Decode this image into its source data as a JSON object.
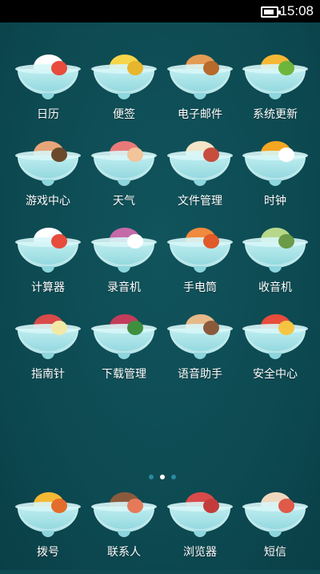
{
  "status_bar": {
    "time": "15:08",
    "battery_icon": "battery-icon"
  },
  "apps": [
    {
      "label": "日历",
      "icon": "calendar-icon",
      "colors": [
        "#ffffff",
        "#e74c3c"
      ]
    },
    {
      "label": "便签",
      "icon": "notes-icon",
      "colors": [
        "#f7d54a",
        "#e7b62d"
      ]
    },
    {
      "label": "电子邮件",
      "icon": "email-icon",
      "colors": [
        "#e39b55",
        "#b76a2c"
      ]
    },
    {
      "label": "系统更新",
      "icon": "system-update-icon",
      "colors": [
        "#f5b835",
        "#6db53c"
      ]
    },
    {
      "label": "游戏中心",
      "icon": "game-center-icon",
      "colors": [
        "#e7a57a",
        "#6a4a2a"
      ]
    },
    {
      "label": "天气",
      "icon": "weather-icon",
      "colors": [
        "#e97a7a",
        "#f2c49a"
      ]
    },
    {
      "label": "文件管理",
      "icon": "file-manager-icon",
      "colors": [
        "#f3e5c8",
        "#c74d3d"
      ]
    },
    {
      "label": "时钟",
      "icon": "clock-icon",
      "colors": [
        "#f5a623",
        "#ffffff"
      ]
    },
    {
      "label": "计算器",
      "icon": "calculator-icon",
      "colors": [
        "#ffffff",
        "#e74c3c"
      ]
    },
    {
      "label": "录音机",
      "icon": "recorder-icon",
      "colors": [
        "#c46aa8",
        "#ffffff"
      ]
    },
    {
      "label": "手电筒",
      "icon": "flashlight-icon",
      "colors": [
        "#f08a3e",
        "#e05a2a"
      ]
    },
    {
      "label": "收音机",
      "icon": "radio-icon",
      "colors": [
        "#b7d88a",
        "#6b9a48"
      ]
    },
    {
      "label": "指南针",
      "icon": "compass-icon",
      "colors": [
        "#d94a4a",
        "#f3e9a6"
      ]
    },
    {
      "label": "下载管理",
      "icon": "download-manager-icon",
      "colors": [
        "#c33c5b",
        "#3f8f3f"
      ]
    },
    {
      "label": "语音助手",
      "icon": "voice-assistant-icon",
      "colors": [
        "#e6b98a",
        "#8b5a3c"
      ]
    },
    {
      "label": "安全中心",
      "icon": "security-center-icon",
      "colors": [
        "#e74c3c",
        "#f5c542"
      ]
    }
  ],
  "page_indicator": {
    "count": 3,
    "active": 1
  },
  "dock": [
    {
      "label": "拨号",
      "icon": "dialer-icon",
      "colors": [
        "#f5b835",
        "#e36d2a"
      ]
    },
    {
      "label": "联系人",
      "icon": "contacts-icon",
      "colors": [
        "#8b5a3c",
        "#e57a5a"
      ]
    },
    {
      "label": "浏览器",
      "icon": "browser-icon",
      "colors": [
        "#d94a4a",
        "#c33c3c"
      ]
    },
    {
      "label": "短信",
      "icon": "sms-icon",
      "colors": [
        "#f0d8c0",
        "#e05a4a"
      ]
    }
  ]
}
